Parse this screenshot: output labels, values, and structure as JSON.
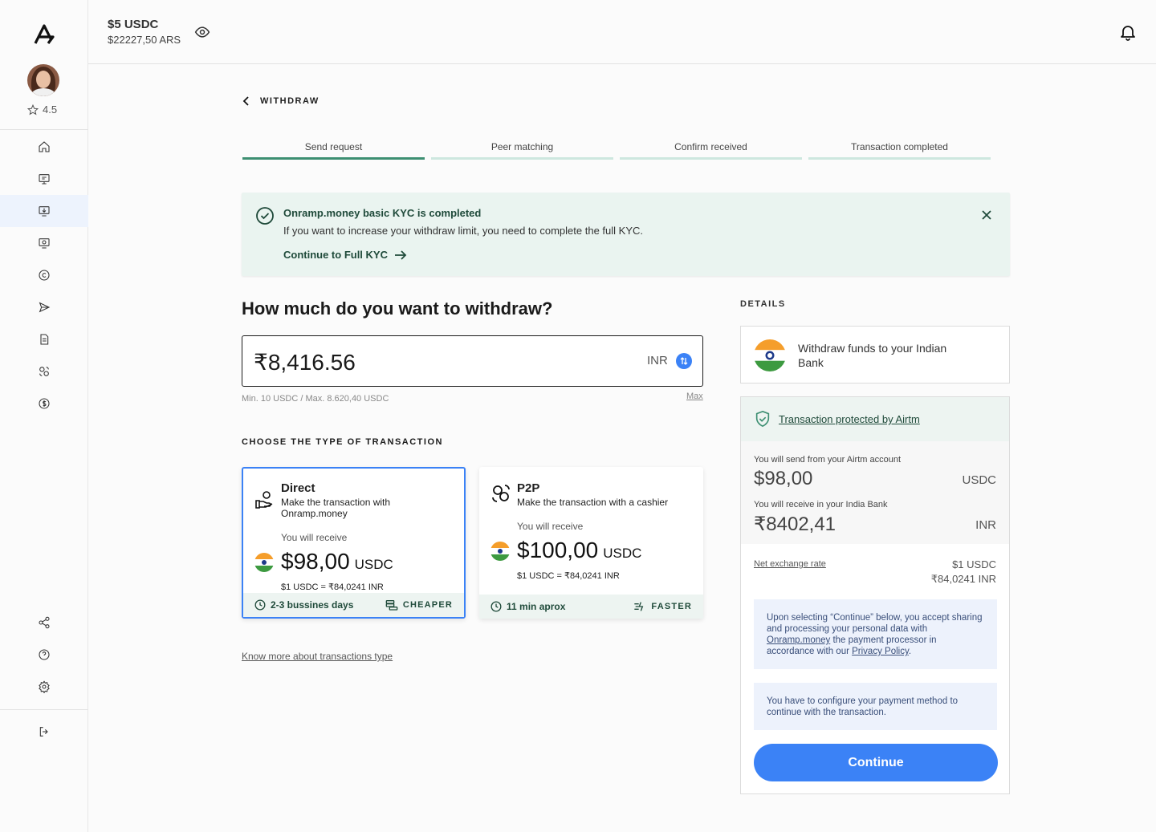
{
  "header": {
    "balance_usdc": "$5 USDC",
    "balance_ars": "$22227,50 ARS"
  },
  "sidebar": {
    "rating": "4.5"
  },
  "page": {
    "back_label": "WITHDRAW"
  },
  "steps": [
    "Send request",
    "Peer matching",
    "Confirm received",
    "Transaction completed"
  ],
  "kyc": {
    "title": "Onramp.money basic KYC is completed",
    "message": "If you want to increase your withdraw limit, you need to complete the full KYC.",
    "link": "Continue to Full KYC"
  },
  "withdraw": {
    "question": "How much do you want to withdraw?",
    "amount": "₹8,416.56",
    "currency": "INR",
    "limits": "Min. 10 USDC / Max. 8.620,40 USDC",
    "max_label": "Max"
  },
  "choose_label": "CHOOSE THE TYPE OF TRANSACTION",
  "cards": [
    {
      "title": "Direct",
      "subtitle": "Make the transaction with Onramp.money",
      "receive_label": "You will receive",
      "amount": "$98,00",
      "unit": "USDC",
      "rate": "$1 USDC = ₹84,0241 INR",
      "time": "2-3 bussines days",
      "tag": "CHEAPER"
    },
    {
      "title": "P2P",
      "subtitle": "Make the transaction with a cashier",
      "receive_label": "You will receive",
      "amount": "$100,00",
      "unit": "USDC",
      "rate": "$1 USDC = ₹84,0241 INR",
      "time": "11 min aprox",
      "tag": "FASTER"
    }
  ],
  "know_more": "Know more about transactions type",
  "details": {
    "label": "DETAILS",
    "bank_text": "Withdraw funds to your Indian Bank",
    "protected": "Transaction protected by Airtm",
    "send_label": "You will send from your Airtm account",
    "send_value": "$98,00",
    "send_currency": "USDC",
    "receive_label": "You will receive in your India Bank",
    "receive_value": "₹8402,41",
    "receive_currency": "INR",
    "rate_label": "Net exchange rate",
    "rate_1": "$1 USDC",
    "rate_2": "₹84,0241 INR",
    "consent_1": "Upon selecting “Continue” below, you accept sharing and processing your personal data with ",
    "consent_link": "Onramp.money",
    "consent_2": " the payment processor in accordance with our ",
    "privacy": "Privacy Policy",
    "consent_3": ".",
    "configure": "You have to configure your payment method to continue with the transaction.",
    "continue": "Continue"
  },
  "colors": {
    "accent": "#3b82f6",
    "green": "#3d8f72",
    "kyc_bg": "#eaf4f0"
  },
  "icons": [
    "home-icon",
    "exchange-icon",
    "withdraw-icon",
    "deposit-icon",
    "coin-icon",
    "send-icon",
    "document-icon",
    "p2p-icon",
    "dollar-icon",
    "share-icon",
    "help-icon",
    "settings-icon",
    "logout-icon"
  ]
}
